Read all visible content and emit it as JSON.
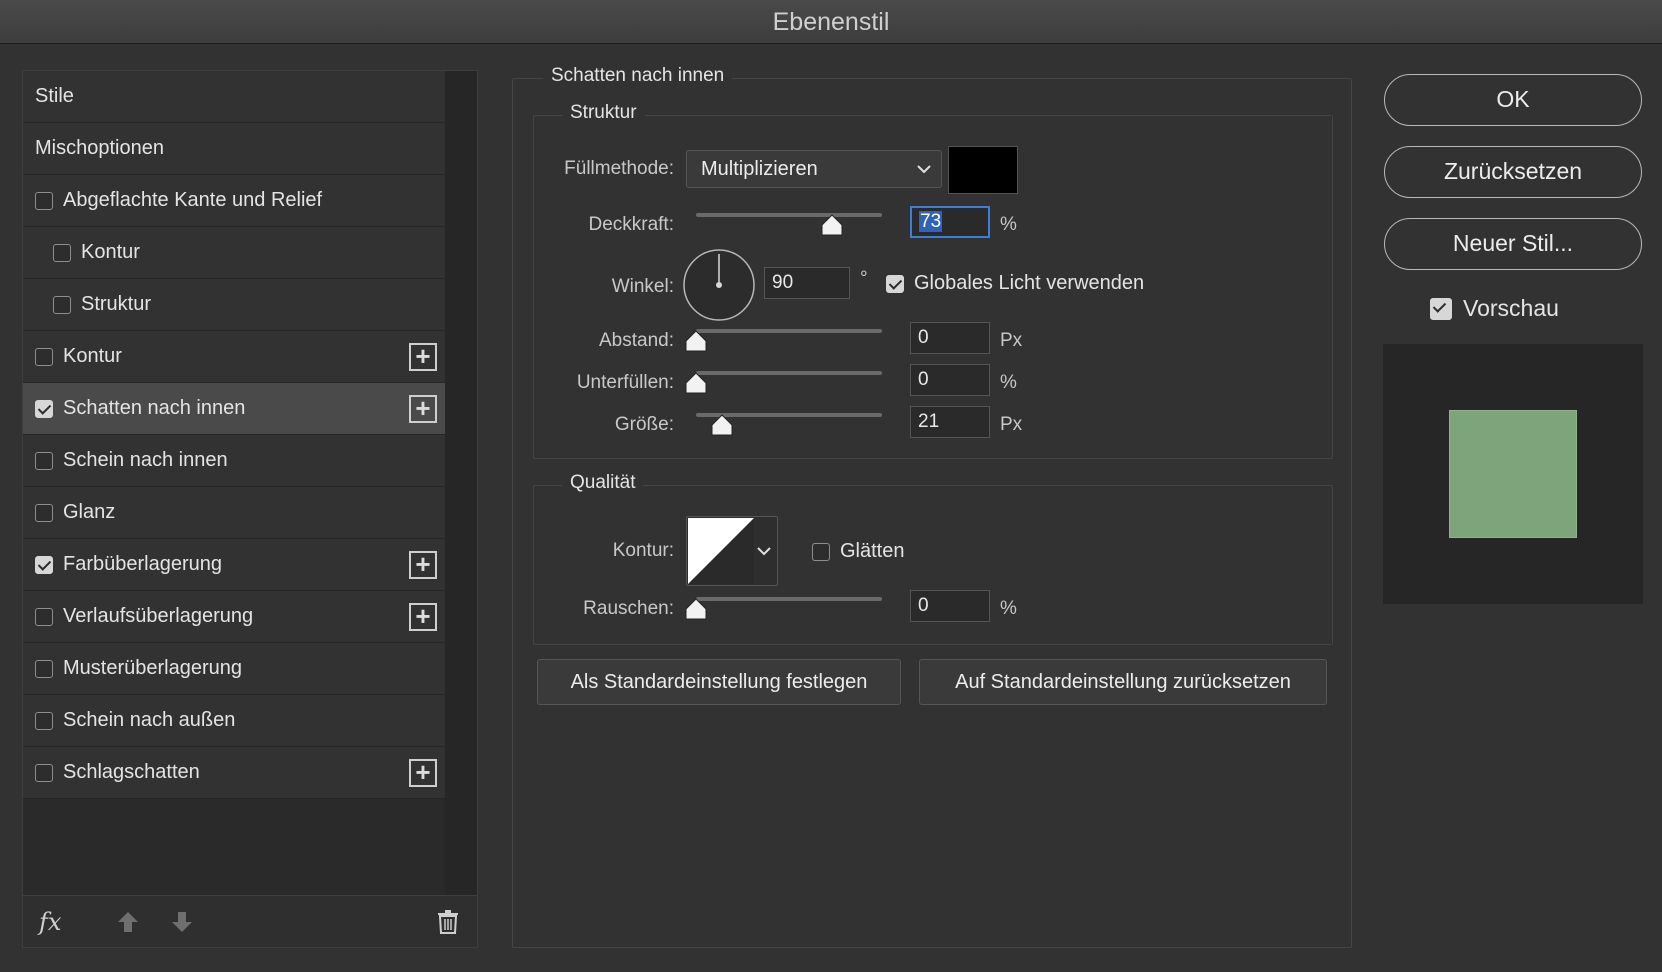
{
  "window": {
    "title": "Ebenenstil"
  },
  "style_list": {
    "items": [
      {
        "label": "Stile",
        "checkbox": false,
        "checked": false,
        "indent": 0,
        "plus": false,
        "selected": false
      },
      {
        "label": "Mischoptionen",
        "checkbox": false,
        "checked": false,
        "indent": 0,
        "plus": false,
        "selected": false
      },
      {
        "label": "Abgeflachte Kante und Relief",
        "checkbox": true,
        "checked": false,
        "indent": 0,
        "plus": false,
        "selected": false
      },
      {
        "label": "Kontur",
        "checkbox": true,
        "checked": false,
        "indent": 1,
        "plus": false,
        "selected": false
      },
      {
        "label": "Struktur",
        "checkbox": true,
        "checked": false,
        "indent": 1,
        "plus": false,
        "selected": false
      },
      {
        "label": "Kontur",
        "checkbox": true,
        "checked": false,
        "indent": 0,
        "plus": true,
        "selected": false
      },
      {
        "label": "Schatten nach innen",
        "checkbox": true,
        "checked": true,
        "indent": 0,
        "plus": true,
        "selected": true
      },
      {
        "label": "Schein nach innen",
        "checkbox": true,
        "checked": false,
        "indent": 0,
        "plus": false,
        "selected": false
      },
      {
        "label": "Glanz",
        "checkbox": true,
        "checked": false,
        "indent": 0,
        "plus": false,
        "selected": false
      },
      {
        "label": "Farbüberlagerung",
        "checkbox": true,
        "checked": true,
        "indent": 0,
        "plus": true,
        "selected": false
      },
      {
        "label": "Verlaufsüberlagerung",
        "checkbox": true,
        "checked": false,
        "indent": 0,
        "plus": true,
        "selected": false
      },
      {
        "label": "Musterüberlagerung",
        "checkbox": true,
        "checked": false,
        "indent": 0,
        "plus": false,
        "selected": false
      },
      {
        "label": "Schein nach außen",
        "checkbox": true,
        "checked": false,
        "indent": 0,
        "plus": false,
        "selected": false
      },
      {
        "label": "Schlagschatten",
        "checkbox": true,
        "checked": false,
        "indent": 0,
        "plus": true,
        "selected": false
      }
    ],
    "footer": {
      "fx_label": "fx",
      "icons": [
        "fx-menu-icon",
        "move-up-icon",
        "move-down-icon",
        "trash-icon"
      ]
    }
  },
  "panel": {
    "title": "Schatten nach innen",
    "structure": {
      "legend": "Struktur",
      "blend_mode": {
        "label": "Füllmethode:",
        "value": "Multiplizieren",
        "color": "#000000"
      },
      "opacity": {
        "label": "Deckkraft:",
        "value": "73",
        "unit": "%",
        "fraction": 0.73
      },
      "angle": {
        "label": "Winkel:",
        "value": "90",
        "unit": "°",
        "global_light_label": "Globales Licht verwenden",
        "global_light_checked": true
      },
      "distance": {
        "label": "Abstand:",
        "value": "0",
        "unit": "Px",
        "fraction": 0.0
      },
      "choke": {
        "label": "Unterfüllen:",
        "value": "0",
        "unit": "%",
        "fraction": 0.0
      },
      "size": {
        "label": "Größe:",
        "value": "21",
        "unit": "Px",
        "fraction": 0.14
      }
    },
    "quality": {
      "legend": "Qualität",
      "contour": {
        "label": "Kontur:",
        "antialias_label": "Glätten",
        "antialias_checked": false
      },
      "noise": {
        "label": "Rauschen:",
        "value": "0",
        "unit": "%",
        "fraction": 0.0
      }
    },
    "buttons": {
      "make_default": "Als Standardeinstellung festlegen",
      "reset_default": "Auf Standardeinstellung zurücksetzen"
    }
  },
  "actions": {
    "ok": "OK",
    "reset": "Zurücksetzen",
    "new_style": "Neuer Stil...",
    "preview_label": "Vorschau",
    "preview_checked": true,
    "preview_color": "#7da47b"
  }
}
